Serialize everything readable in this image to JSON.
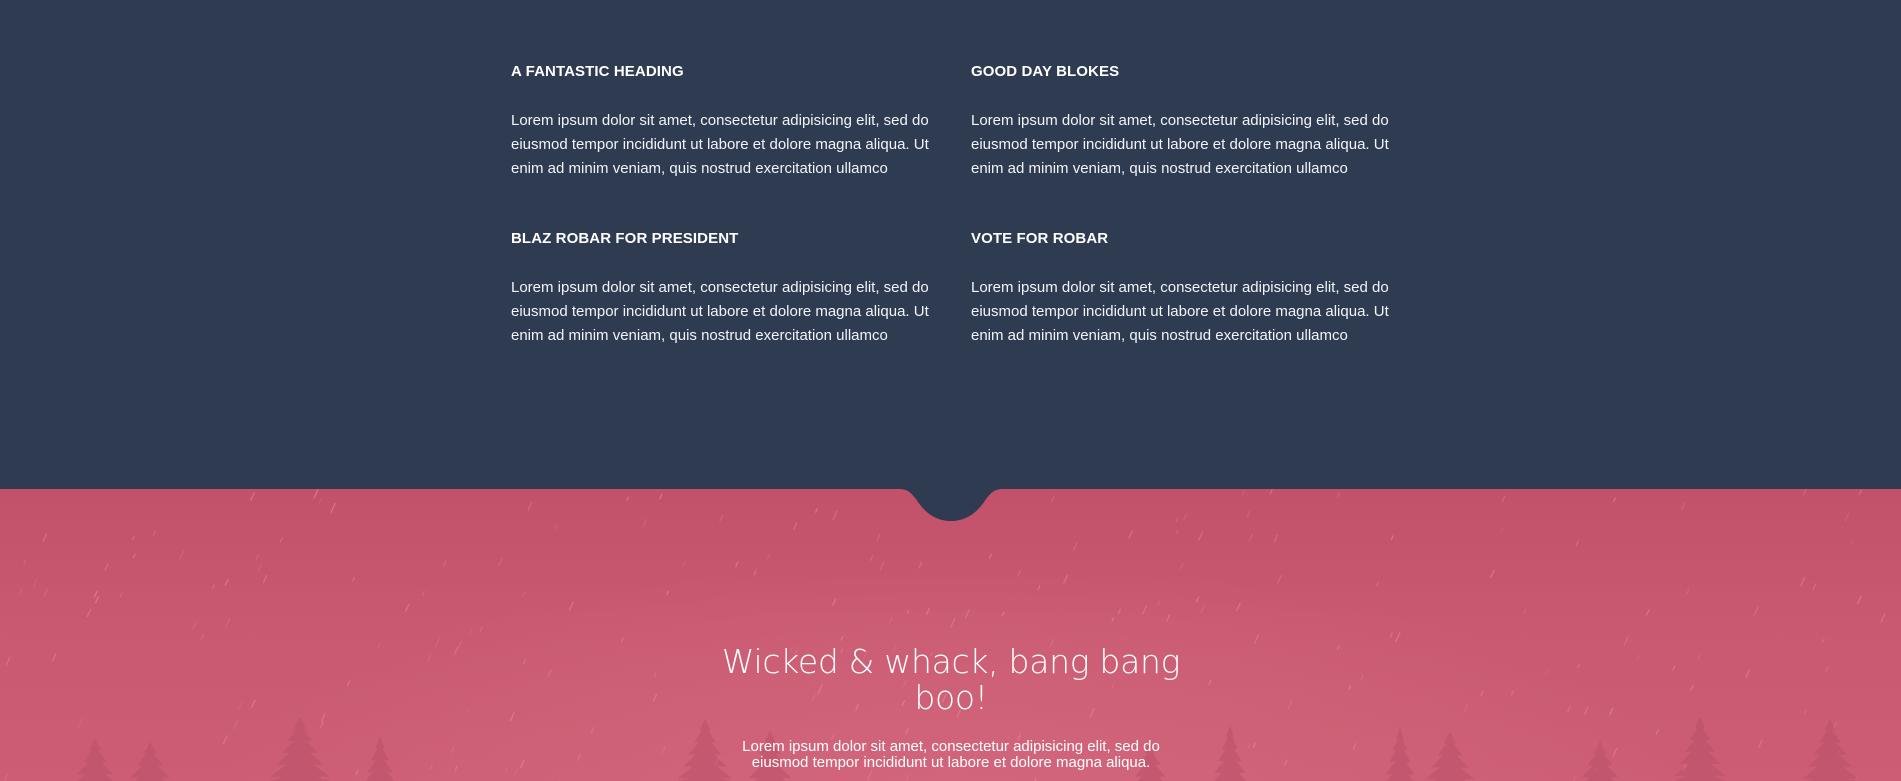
{
  "features": [
    {
      "heading": "A FANTASTIC HEADING",
      "body": "Lorem ipsum dolor sit amet, consectetur adipisicing elit, sed do eiusmod tempor incididunt ut labore et dolore magna aliqua. Ut enim ad minim veniam, quis nostrud exercitation ullamco"
    },
    {
      "heading": "GOOD DAY BLOKES",
      "body": "Lorem ipsum dolor sit amet, consectetur adipisicing elit, sed do eiusmod tempor incididunt ut labore et dolore magna aliqua. Ut enim ad minim veniam, quis nostrud exercitation ullamco"
    },
    {
      "heading": "BLAZ ROBAR FOR PRESIDENT",
      "body": "Lorem ipsum dolor sit amet, consectetur adipisicing elit, sed do eiusmod tempor incididunt ut labore et dolore magna aliqua. Ut enim ad minim veniam, quis nostrud exercitation ullamco"
    },
    {
      "heading": "VOTE FOR ROBAR",
      "body": "Lorem ipsum dolor sit amet, consectetur adipisicing elit, sed do eiusmod tempor incididunt ut labore et dolore magna aliqua. Ut enim ad minim veniam, quis nostrud exercitation ullamco"
    }
  ],
  "hero": {
    "title": "Wicked & whack, bang bang boo!",
    "text": "Lorem ipsum dolor sit amet, consectetur adipisicing elit, sed do eiusmod tempor incididunt ut labore et dolore magna aliqua."
  },
  "colors": {
    "dark_section": "#2e3b51",
    "hero_pink": "#c95a72",
    "text": "#ffffff"
  }
}
